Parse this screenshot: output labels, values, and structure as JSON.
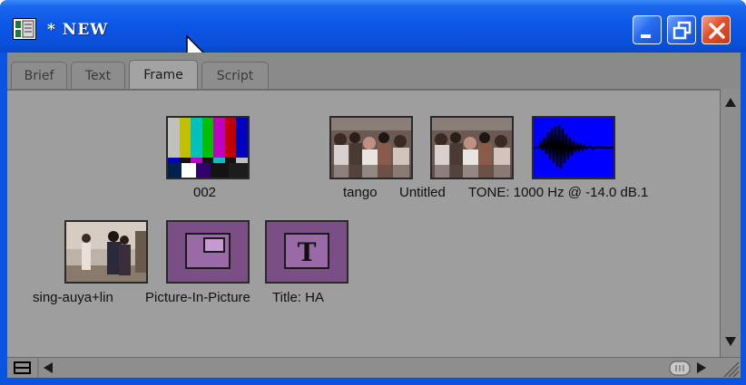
{
  "window": {
    "title": "* NEW",
    "buttons": {
      "minimize": "minimize",
      "restore": "restore",
      "close": "close"
    }
  },
  "tabs": [
    {
      "label": "Brief",
      "active": false
    },
    {
      "label": "Text",
      "active": false
    },
    {
      "label": "Frame",
      "active": true
    },
    {
      "label": "Script",
      "active": false
    }
  ],
  "items": [
    {
      "label": "002",
      "kind": "color-bars"
    },
    {
      "label": "tango",
      "kind": "video-crowd"
    },
    {
      "label": "Untitled",
      "kind": "video-crowd"
    },
    {
      "label": "TONE: 1000 Hz @ -14.0 dB.1",
      "kind": "audio-waveform"
    },
    {
      "label": "sing-auya+lin",
      "kind": "video-dance"
    },
    {
      "label": "Picture-In-Picture",
      "kind": "effect-pip"
    },
    {
      "label": "Title: HA",
      "kind": "effect-title"
    }
  ],
  "colors": {
    "titlebar": "#0a54e0",
    "content_bg": "#9e9e9e",
    "audio_bg": "#0000ff",
    "effect_bg": "#7a4f86"
  }
}
